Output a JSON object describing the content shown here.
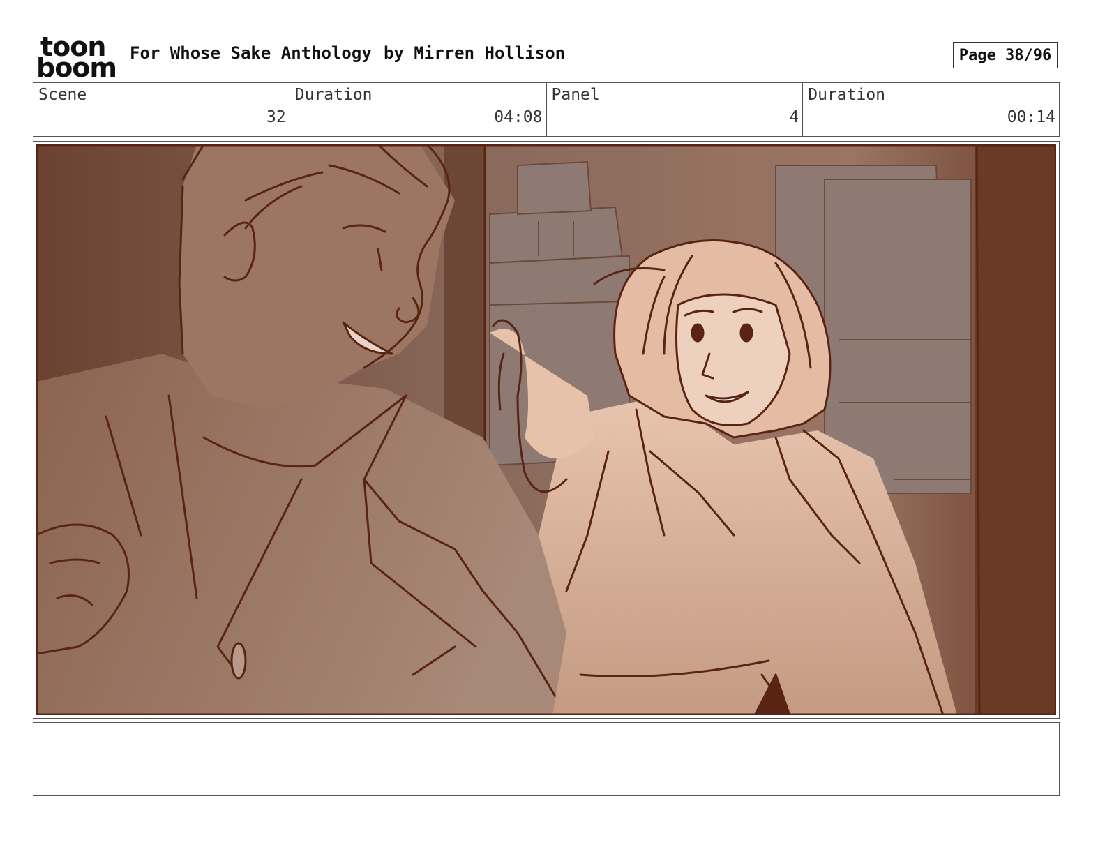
{
  "header": {
    "logo_line1": "toon",
    "logo_line2": "boom",
    "title": "For Whose Sake Anthology",
    "author": "by Mirren Hollison",
    "page": "Page 38/96"
  },
  "info": {
    "scene_label": "Scene",
    "scene_value": "32",
    "duration_label": "Duration",
    "duration_value": "04:08",
    "panel_label": "Panel",
    "panel_value": "4",
    "panel_duration_label": "Duration",
    "panel_duration_value": "00:14"
  },
  "colors": {
    "ink": "#5a2414",
    "bg_dark": "#6e4331",
    "skin_light": "#e2bba5",
    "skin_mid": "#b88a72"
  }
}
